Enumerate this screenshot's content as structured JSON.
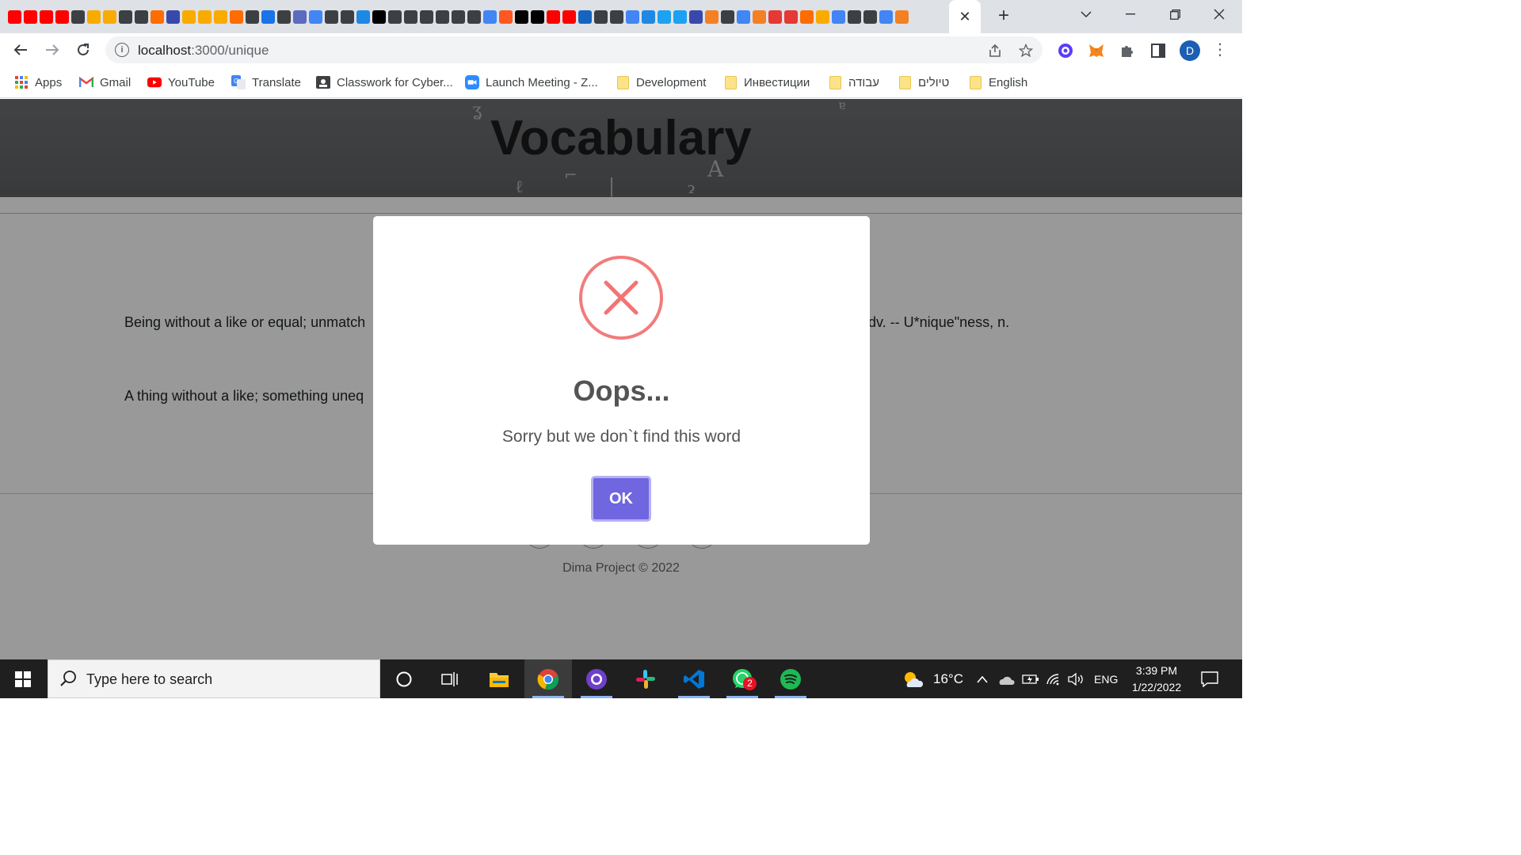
{
  "browser": {
    "active_tab_close": "✕",
    "new_tab": "+",
    "url_host": "localhost",
    "url_rest": ":3000/unique",
    "profile_initial": "D"
  },
  "bookmarks": [
    {
      "label": "Apps",
      "icon": "apps-grid-icon"
    },
    {
      "label": "Gmail",
      "icon": "gmail-icon"
    },
    {
      "label": "YouTube",
      "icon": "youtube-icon"
    },
    {
      "label": "Translate",
      "icon": "translate-icon"
    },
    {
      "label": "Classwork for Cyber...",
      "icon": "classroom-icon"
    },
    {
      "label": "Launch Meeting - Z...",
      "icon": "zoom-icon"
    },
    {
      "label": "Development",
      "icon": "folder-icon"
    },
    {
      "label": "Инвестиции",
      "icon": "folder-icon"
    },
    {
      "label": "עבודה",
      "icon": "folder-icon"
    },
    {
      "label": "טיולים",
      "icon": "folder-icon"
    },
    {
      "label": "English",
      "icon": "folder-icon"
    }
  ],
  "page": {
    "title": "Vocabulary",
    "definitions": [
      {
        "left": "Being without a like or equal; unmatch",
        "right": "dv. -- U*nique\"ness, n."
      },
      {
        "left": "A thing without a like; something uneq",
        "right": ""
      }
    ],
    "footer": "Dima Project © 2022"
  },
  "modal": {
    "title": "Oops...",
    "text": "Sorry but we don`t find this word",
    "button": "OK",
    "icon_color": "#f27474",
    "button_color": "#7066e0"
  },
  "taskbar": {
    "search_placeholder": "Type here to search",
    "temperature": "16°C",
    "language": "ENG",
    "time": "3:39 PM",
    "date": "1/22/2022",
    "whatsapp_badge": "2"
  }
}
